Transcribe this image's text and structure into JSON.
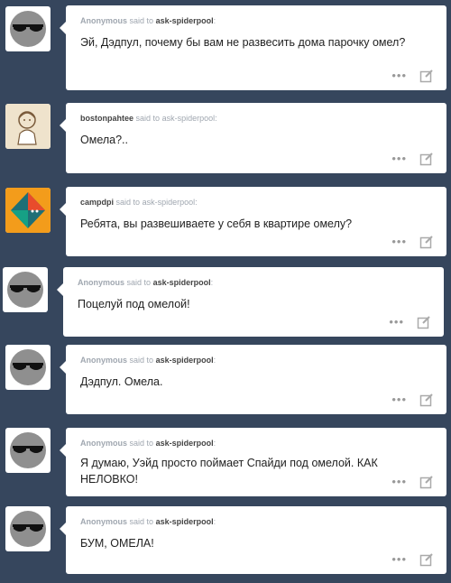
{
  "colors": {
    "background": "#36465d",
    "card": "#ffffff",
    "user_bold": "#444444",
    "meta": "#a0a7b0"
  },
  "said_to": "said to",
  "posts": [
    {
      "author": "Anonymous",
      "recipient": "ask-spiderpool",
      "message": "Эй, Дэдпул, почему бы вам не развесить дома парочку омел?",
      "avatar": "anonymous-sunglasses"
    },
    {
      "author": "bostonpahtee",
      "recipient": "ask-spiderpool",
      "message": "Омела?..",
      "avatar": "sketch-character"
    },
    {
      "author": "campdpi",
      "recipient": "ask-spiderpool",
      "message": "Ребята, вы развешиваете у себя в квартире омелу?",
      "avatar": "orange-diamond"
    },
    {
      "author": "Anonymous",
      "recipient": "ask-spiderpool",
      "message": "Поцелуй под омелой!",
      "avatar": "anonymous-sunglasses"
    },
    {
      "author": "Anonymous",
      "recipient": "ask-spiderpool",
      "message": "Дэдпул. Омела.",
      "avatar": "anonymous-sunglasses"
    },
    {
      "author": "Anonymous",
      "recipient": "ask-spiderpool",
      "message": "Я думаю, Уэйд просто поймает Спайди под омелой. КАК НЕЛОВКО!",
      "avatar": "anonymous-sunglasses"
    },
    {
      "author": "Anonymous",
      "recipient": "ask-spiderpool",
      "message": "БУМ, ОМЕЛА!",
      "avatar": "anonymous-sunglasses"
    }
  ]
}
